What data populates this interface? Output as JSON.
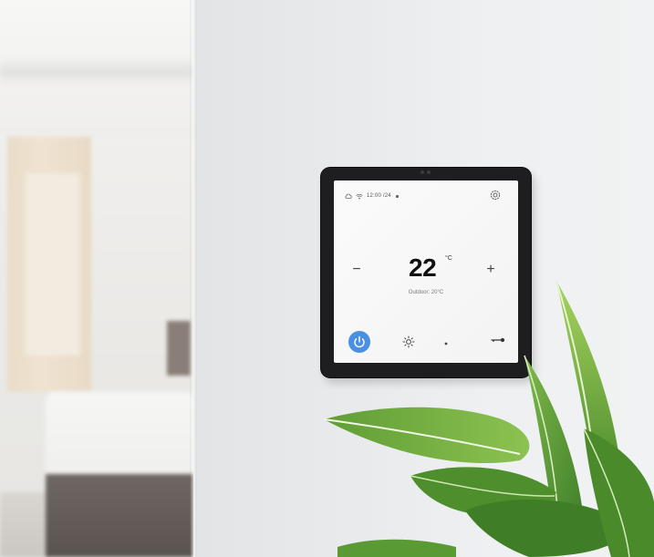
{
  "thermostat": {
    "status": {
      "cloud_icon": "cloud-icon",
      "wifi_icon": "wifi-icon",
      "time": "12:00 /24",
      "indicator_icon": "sun-small-icon"
    },
    "temperature": "22",
    "unit": "°C",
    "subtitle": "Outdoor: 20°C",
    "decrease_label": "−",
    "increase_label": "+",
    "settings_icon": "gear-icon",
    "bottom_icons": [
      "power-icon",
      "sun-icon",
      "dot-icon",
      "key-icon"
    ],
    "power_color": "#4a90e2"
  }
}
